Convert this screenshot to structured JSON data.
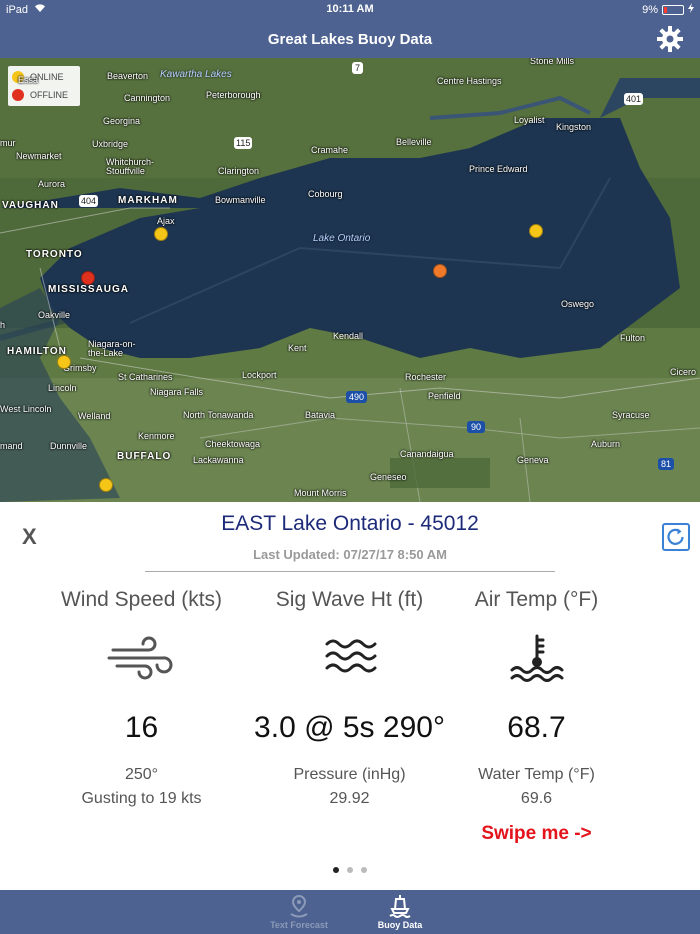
{
  "status_bar": {
    "device": "iPad",
    "time": "10:11 AM",
    "battery": "9%"
  },
  "nav": {
    "title": "Great Lakes Buoy Data",
    "settings_icon": "gear-icon"
  },
  "map": {
    "legend": {
      "online": "ONLINE",
      "offline": "OFFLINE"
    },
    "labels": {
      "beaverton": "Beaverton",
      "kawartha": "Kawartha Lakes",
      "stone_mills": "Stone Mills",
      "essa": "Essa",
      "cannington": "Cannington",
      "peterborough": "Peterborough",
      "centre_hastings": "Centre Hastings",
      "georgina": "Georgina",
      "loyalist": "Loyalist",
      "kingston": "Kingston",
      "newmarket": "Newmarket",
      "uxbridge": "Uxbridge",
      "cramahe": "Cramahe",
      "belleville": "Belleville",
      "whitchurch": "Whitchurch-\nStouffville",
      "aurora": "Aurora",
      "clarington": "Clarington",
      "prince_edward": "Prince Edward",
      "vaughan": "VAUGHAN",
      "markham": "MARKHAM",
      "bowmanville": "Bowmanville",
      "cobourg": "Cobourg",
      "ajax": "Ajax",
      "lake_ontario": "Lake Ontario",
      "toronto": "TORONTO",
      "mississauga": "MISSISSAUGA",
      "oswego": "Oswego",
      "oakville": "Oakville",
      "fulton": "Fulton",
      "kendall": "Kendall",
      "kent": "Kent",
      "niagara_lake": "Niagara-on-\nthe-Lake",
      "hamilton": "HAMILTON",
      "grimsby": "Grimsby",
      "st_catharines": "St Catharines",
      "lockport": "Lockport",
      "rochester": "Rochester",
      "cicero": "Cicero",
      "lincoln": "Lincoln",
      "niagara_falls": "Niagara Falls",
      "penfield": "Penfield",
      "west_lincoln": "West Lincoln",
      "welland": "Welland",
      "north_tonawanda": "North Tonawanda",
      "batavia": "Batavia",
      "syracuse": "Syracuse",
      "dunnville": "Dunnville",
      "kenmore": "Kenmore",
      "cheektowaga": "Cheektowaga",
      "auburn": "Auburn",
      "mand": "mand",
      "buffalo": "BUFFALO",
      "lackawanna": "Lackawanna",
      "canandaigua": "Canandaigua",
      "geneva": "Geneva",
      "geneseo": "Geneseo",
      "mount_morris": "Mount Morris",
      "mur": "mur",
      "h": "h"
    },
    "shields": {
      "r7": "7",
      "r401a": "401",
      "r115": "115",
      "r404": "404",
      "r490": "490",
      "r90": "90",
      "r81": "81"
    },
    "colors": {
      "online": "#f5c518",
      "offline": "#e0301e",
      "selected": "#f07a2a"
    }
  },
  "station": {
    "title": "EAST Lake Ontario - 45012",
    "last_updated": "Last Updated: 07/27/17 8:50 AM",
    "close_label": "X",
    "refresh_icon": "refresh-icon"
  },
  "metrics": {
    "wind": {
      "heading": "Wind Speed (kts)",
      "icon": "wind-icon",
      "value": "16",
      "direction": "250°",
      "gust": "Gusting to 19 kts"
    },
    "wave": {
      "heading": "Sig Wave Ht (ft)",
      "icon": "waves-icon",
      "value": "3.0 @ 5s 290°",
      "pressure_label": "Pressure (inHg)",
      "pressure_value": "29.92"
    },
    "air": {
      "heading": "Air Temp (°F)",
      "icon": "water-temperature-icon",
      "value": "68.7",
      "water_label": "Water Temp (°F)",
      "water_value": "69.6",
      "swipe": "Swipe me ->"
    }
  },
  "pager": {
    "pages": 3,
    "active": 1
  },
  "tabs": [
    {
      "label": "Text Forecast",
      "icon": "location-pin-icon",
      "active": false
    },
    {
      "label": "Buoy Data",
      "icon": "buoy-icon",
      "active": true
    }
  ]
}
